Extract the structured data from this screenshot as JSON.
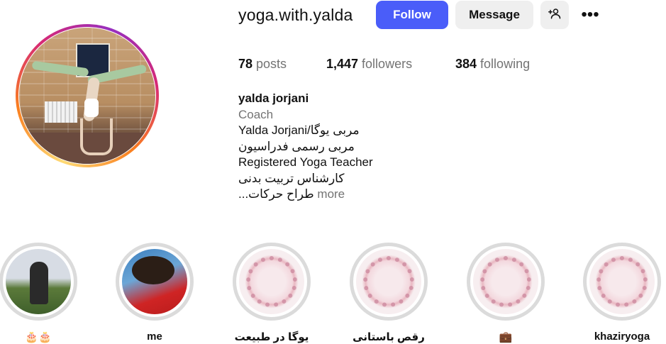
{
  "profile": {
    "username": "yoga.with.yalda",
    "buttons": {
      "follow": "Follow",
      "message": "Message",
      "more": "•••"
    },
    "stats": {
      "posts_count": "78",
      "posts_label": " posts",
      "followers_count": "1,447",
      "followers_label": " followers",
      "following_count": "384",
      "following_label": " following"
    },
    "bio": {
      "full_name": "yalda jorjani",
      "category": "Coach",
      "lines": [
        "Yalda Jorjani/مربی یوگا",
        "مربی رسمی فدراسیون",
        "Registered Yoga Teacher",
        "کارشناس تربیت بدنی",
        "...طراح حرکات"
      ],
      "more": "more"
    }
  },
  "highlights": [
    {
      "label": "🎂🎂"
    },
    {
      "label": "me"
    },
    {
      "label": "یوگا در طبیعت"
    },
    {
      "label": "رقص باستانی"
    },
    {
      "label": "💼"
    },
    {
      "label": "khaziryoga"
    }
  ],
  "colors": {
    "follow_button": "#4a5df9",
    "secondary_button": "#efefef",
    "muted_text": "#737373",
    "story_ring": [
      "#feda75",
      "#fa7e1e",
      "#d62976",
      "#962fbf"
    ]
  },
  "icons": {
    "add_user": "person-plus-icon",
    "more": "three-dots-icon"
  }
}
